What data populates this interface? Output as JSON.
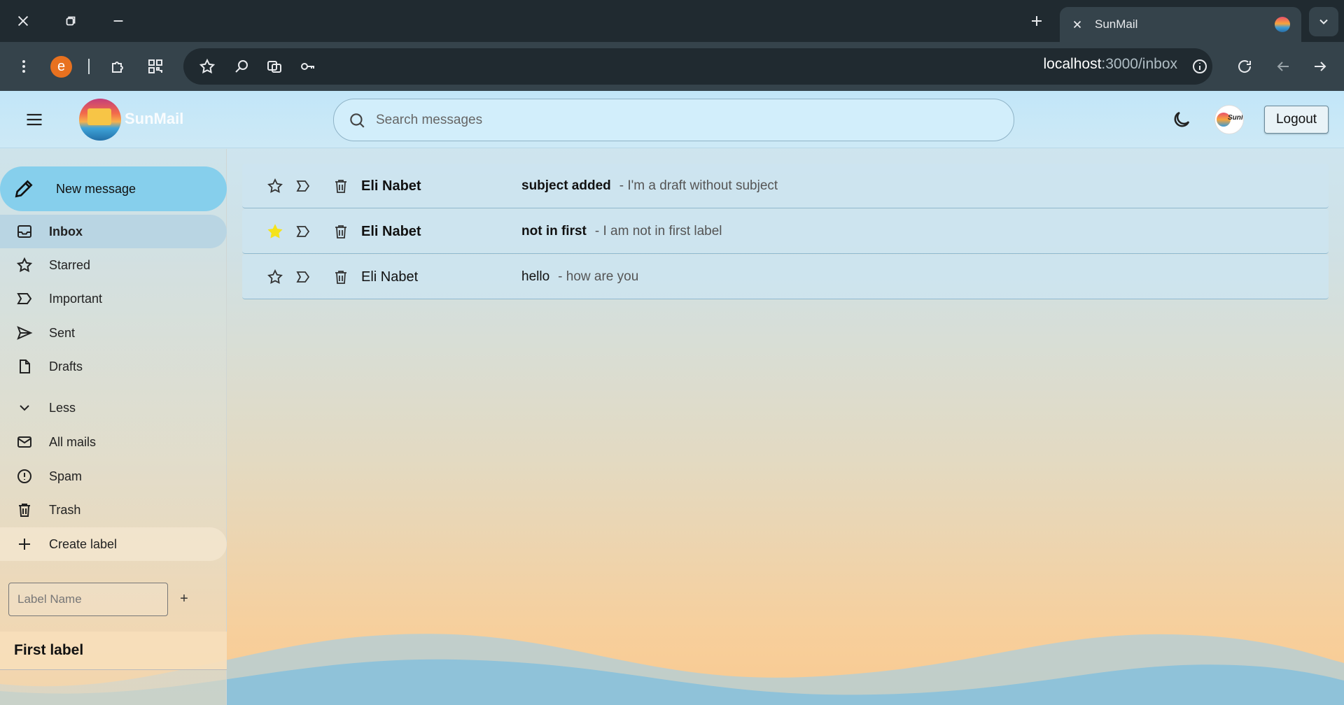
{
  "browser": {
    "tab_title": "SunMail",
    "url_host": "localhost",
    "url_path": ":3000/inbox",
    "profile_letter": "e"
  },
  "app": {
    "logo_text": "SunMail",
    "search_placeholder": "Search messages",
    "logout_label": "Logout",
    "avatar_text": "SunMail"
  },
  "sidebar": {
    "new_message": "New message",
    "items": [
      {
        "label": "Inbox",
        "icon": "inbox-icon"
      },
      {
        "label": "Starred",
        "icon": "star-icon"
      },
      {
        "label": "Important",
        "icon": "important-icon"
      },
      {
        "label": "Sent",
        "icon": "send-icon"
      },
      {
        "label": "Drafts",
        "icon": "draft-icon"
      },
      {
        "label": "Less",
        "icon": "chevron-down-icon"
      },
      {
        "label": "All mails",
        "icon": "mail-icon"
      },
      {
        "label": "Spam",
        "icon": "spam-icon"
      },
      {
        "label": "Trash",
        "icon": "trash-icon"
      },
      {
        "label": "Create label",
        "icon": "plus-icon"
      }
    ],
    "label_input_placeholder": "Label Name",
    "label_add": "+",
    "labels": [
      "First label"
    ]
  },
  "messages": [
    {
      "sender": "Eli Nabet",
      "subject": "subject added",
      "snippet": "- I'm a draft without subject",
      "starred": false,
      "unread": true
    },
    {
      "sender": "Eli Nabet",
      "subject": "not in first",
      "snippet": "- I am not in first label",
      "starred": true,
      "unread": true
    },
    {
      "sender": "Eli Nabet",
      "subject": "hello",
      "snippet": "- how are you",
      "starred": false,
      "unread": false
    }
  ],
  "colors": {
    "accent": "#86cfec",
    "star_active": "#f5e31a"
  }
}
